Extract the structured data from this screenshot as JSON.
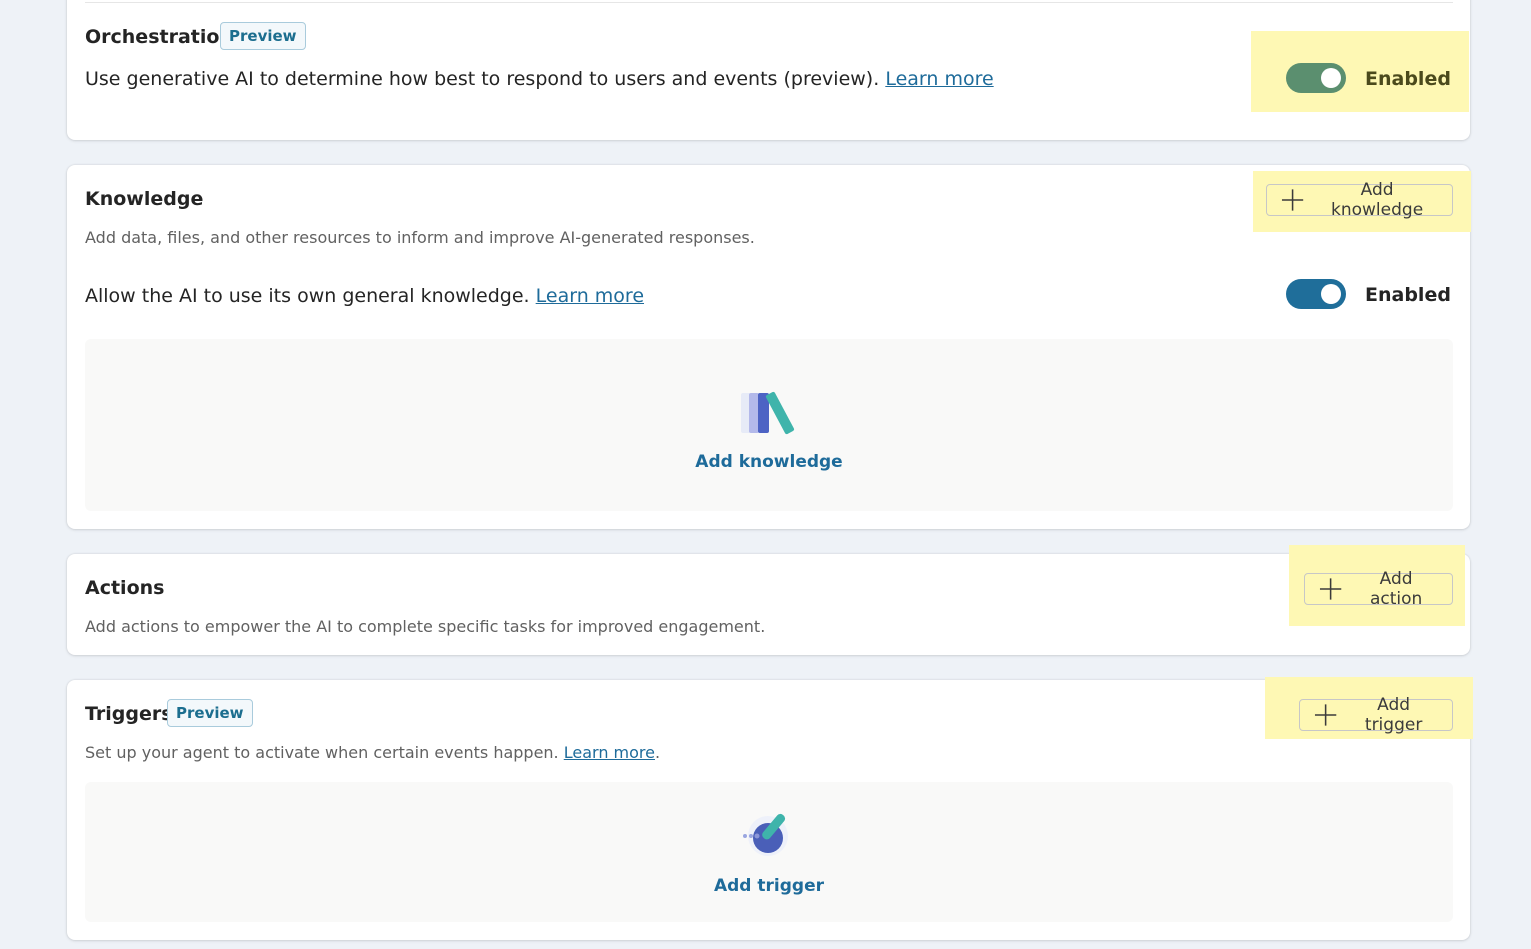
{
  "orchestration": {
    "title": "Orchestration",
    "badge": "Preview",
    "text": "Use generative AI to determine how best to respond to users and events (preview).",
    "learn_more": "Learn more",
    "toggle_label": "Enabled",
    "toggle_on": true,
    "toggle_color": "#5b8f6f"
  },
  "knowledge": {
    "title": "Knowledge",
    "add_button": "Add knowledge",
    "description": "Add data, files, and other resources to inform and improve AI-generated responses.",
    "general_text": "Allow the AI to use its own general knowledge.",
    "learn_more": "Learn more",
    "toggle_label": "Enabled",
    "toggle_on": true,
    "toggle_color": "#1f6e9a",
    "empty_icon": "books-icon",
    "empty_label": "Add knowledge"
  },
  "actions": {
    "title": "Actions",
    "add_button": "Add action",
    "description": "Add actions to empower the AI to complete specific tasks for improved engagement."
  },
  "triggers": {
    "title": "Triggers",
    "badge": "Preview",
    "add_button": "Add trigger",
    "description": "Set up your agent to activate when certain events happen.",
    "learn_more": "Learn more",
    "trailing_period": ".",
    "empty_icon": "trigger-icon",
    "empty_label": "Add trigger"
  },
  "colors": {
    "highlight": "#fef8b4",
    "link": "#1e6b9a",
    "accent": "#1f6e9a"
  }
}
